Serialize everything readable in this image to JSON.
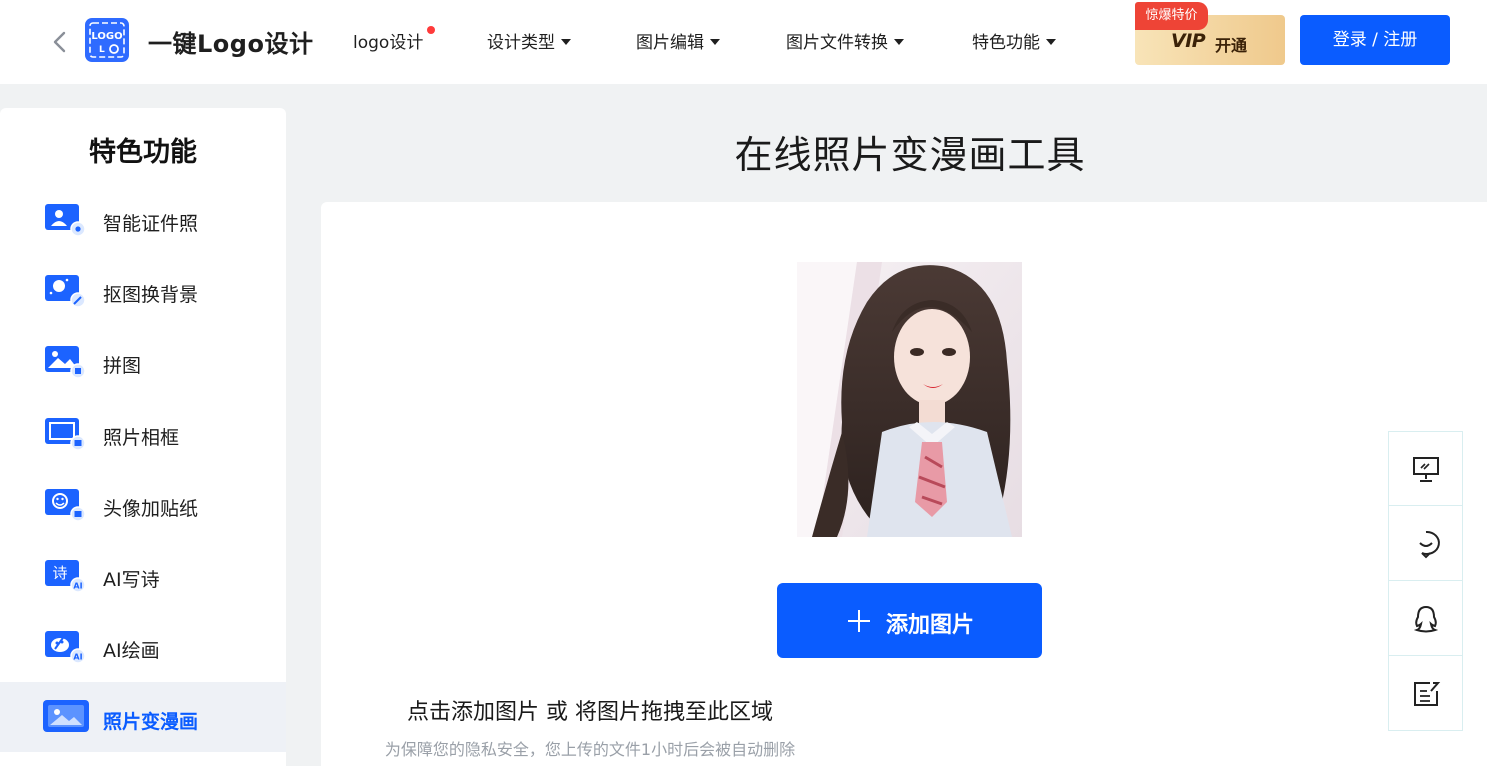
{
  "header": {
    "brand_logo_text": "LOGO",
    "brand_name": "一键Logo设计",
    "nav": [
      {
        "label": "logo设计",
        "has_dot": true,
        "dropdown": false
      },
      {
        "label": "设计类型",
        "dropdown": true
      },
      {
        "label": "图片编辑",
        "dropdown": true
      },
      {
        "label": "图片文件转换",
        "dropdown": true
      },
      {
        "label": "特色功能",
        "dropdown": true
      }
    ],
    "vip_badge": "惊爆特价",
    "vip_label": "VIP",
    "vip_open": "开通",
    "login_label": "登录 / 注册"
  },
  "sidebar": {
    "title": "特色功能",
    "items": [
      {
        "label": "智能证件照",
        "icon": "id-photo-icon"
      },
      {
        "label": "抠图换背景",
        "icon": "cutout-icon"
      },
      {
        "label": "拼图",
        "icon": "puzzle-icon"
      },
      {
        "label": "照片相框",
        "icon": "photo-frame-icon"
      },
      {
        "label": "头像加贴纸",
        "icon": "avatar-sticker-icon"
      },
      {
        "label": "AI写诗",
        "icon": "ai-poem-icon",
        "icon_text": "诗"
      },
      {
        "label": "AI绘画",
        "icon": "ai-paint-icon"
      },
      {
        "label": "照片变漫画",
        "icon": "photo-cartoon-icon",
        "active": true
      }
    ],
    "ai_badge": "AI"
  },
  "main": {
    "title": "在线照片变漫画工具",
    "add_button_label": "添加图片",
    "drop_hint": "点击添加图片 或 将图片拖拽至此区域",
    "privacy_note": "为保障您的隐私安全，您上传的文件1小时后会被自动删除"
  },
  "float_toolbar": [
    {
      "icon": "presentation-icon"
    },
    {
      "icon": "chat-icon"
    },
    {
      "icon": "qq-icon"
    },
    {
      "icon": "feedback-icon"
    }
  ],
  "colors": {
    "primary": "#0a5cff",
    "vip_gold": "#efc98c",
    "badge_red": "#ee4436",
    "page_bg": "#f0f2f3"
  }
}
